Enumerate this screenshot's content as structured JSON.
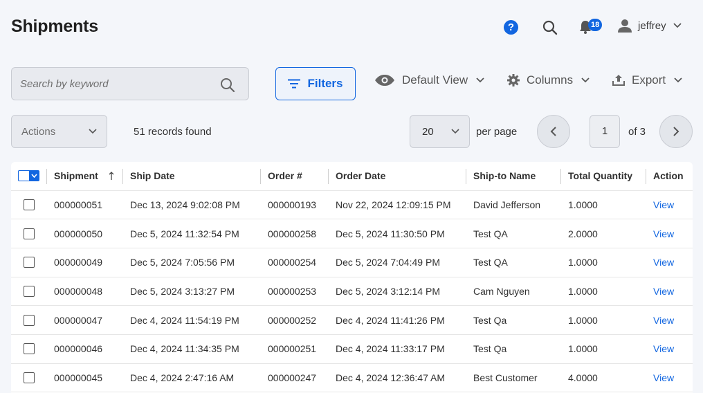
{
  "header": {
    "title": "Shipments",
    "help_label": "?",
    "notification_count": "18",
    "user_name": "jeffrey"
  },
  "toolbar": {
    "search_placeholder": "Search by keyword",
    "filters_label": "Filters",
    "view_label": "Default View",
    "columns_label": "Columns",
    "export_label": "Export"
  },
  "controls": {
    "actions_label": "Actions",
    "records_text": "51 records found",
    "per_page_value": "20",
    "per_page_label": "per page",
    "current_page": "1",
    "total_pages_text": "of 3"
  },
  "grid": {
    "columns": [
      "Shipment",
      "Ship Date",
      "Order #",
      "Order Date",
      "Ship-to Name",
      "Total Quantity",
      "Action"
    ],
    "rows": [
      {
        "shipment": "000000051",
        "ship_date": "Dec 13, 2024 9:02:08 PM",
        "order": "000000193",
        "order_date": "Nov 22, 2024 12:09:15 PM",
        "name": "David Jefferson",
        "qty": "1.0000",
        "action": "View"
      },
      {
        "shipment": "000000050",
        "ship_date": "Dec 5, 2024 11:32:54 PM",
        "order": "000000258",
        "order_date": "Dec 5, 2024 11:30:50 PM",
        "name": "Test QA",
        "qty": "2.0000",
        "action": "View"
      },
      {
        "shipment": "000000049",
        "ship_date": "Dec 5, 2024 7:05:56 PM",
        "order": "000000254",
        "order_date": "Dec 5, 2024 7:04:49 PM",
        "name": "Test QA",
        "qty": "1.0000",
        "action": "View"
      },
      {
        "shipment": "000000048",
        "ship_date": "Dec 5, 2024 3:13:27 PM",
        "order": "000000253",
        "order_date": "Dec 5, 2024 3:12:14 PM",
        "name": "Cam Nguyen",
        "qty": "1.0000",
        "action": "View"
      },
      {
        "shipment": "000000047",
        "ship_date": "Dec 4, 2024 11:54:19 PM",
        "order": "000000252",
        "order_date": "Dec 4, 2024 11:41:26 PM",
        "name": "Test Qa",
        "qty": "1.0000",
        "action": "View"
      },
      {
        "shipment": "000000046",
        "ship_date": "Dec 4, 2024 11:34:35 PM",
        "order": "000000251",
        "order_date": "Dec 4, 2024 11:33:17 PM",
        "name": "Test Qa",
        "qty": "1.0000",
        "action": "View"
      },
      {
        "shipment": "000000045",
        "ship_date": "Dec 4, 2024 2:47:16 AM",
        "order": "000000247",
        "order_date": "Dec 4, 2024 12:36:47 AM",
        "name": "Best Customer",
        "qty": "4.0000",
        "action": "View"
      }
    ]
  },
  "colors": {
    "accent": "#1266e0",
    "background": "#f4f6fa"
  }
}
